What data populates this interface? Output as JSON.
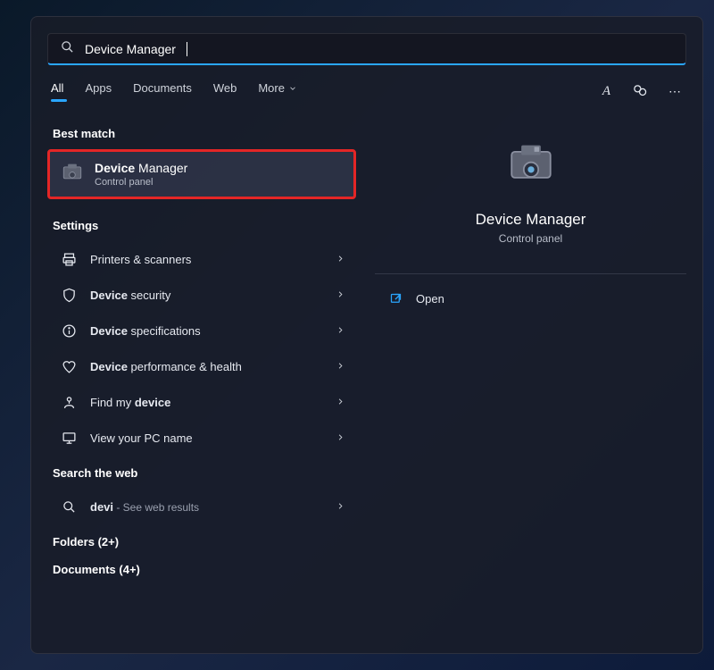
{
  "search": {
    "value": "Device Manager"
  },
  "filters": {
    "tabs": [
      "All",
      "Apps",
      "Documents",
      "Web"
    ],
    "more": "More",
    "active": 0
  },
  "header_icons": {
    "a_label": "A",
    "feedback": "feedback",
    "overflow": "⋯"
  },
  "sections": {
    "best_match": "Best match",
    "settings": "Settings",
    "search_web": "Search the web",
    "folders": "Folders (2+)",
    "documents": "Documents (4+)"
  },
  "best_match_item": {
    "title_pre": "Device",
    "title_bold": " Manager",
    "subtitle": "Control panel"
  },
  "settings_items": [
    {
      "icon": "printer-icon",
      "label": "Printers & scanners"
    },
    {
      "icon": "shield-icon",
      "label_pre": "Device",
      "label_rest": " security"
    },
    {
      "icon": "info-icon",
      "label_pre": "Device",
      "label_rest": " specifications"
    },
    {
      "icon": "heart-icon",
      "label_pre": "Device",
      "label_rest": " performance & health"
    },
    {
      "icon": "findmy-icon",
      "label_pre": "Find my ",
      "label_bold": "device"
    },
    {
      "icon": "pc-icon",
      "label": "View your PC name"
    }
  ],
  "web_item": {
    "query": "devi",
    "suffix": " - See web results"
  },
  "preview": {
    "title": "Device Manager",
    "subtitle": "Control panel",
    "action_open": "Open"
  }
}
